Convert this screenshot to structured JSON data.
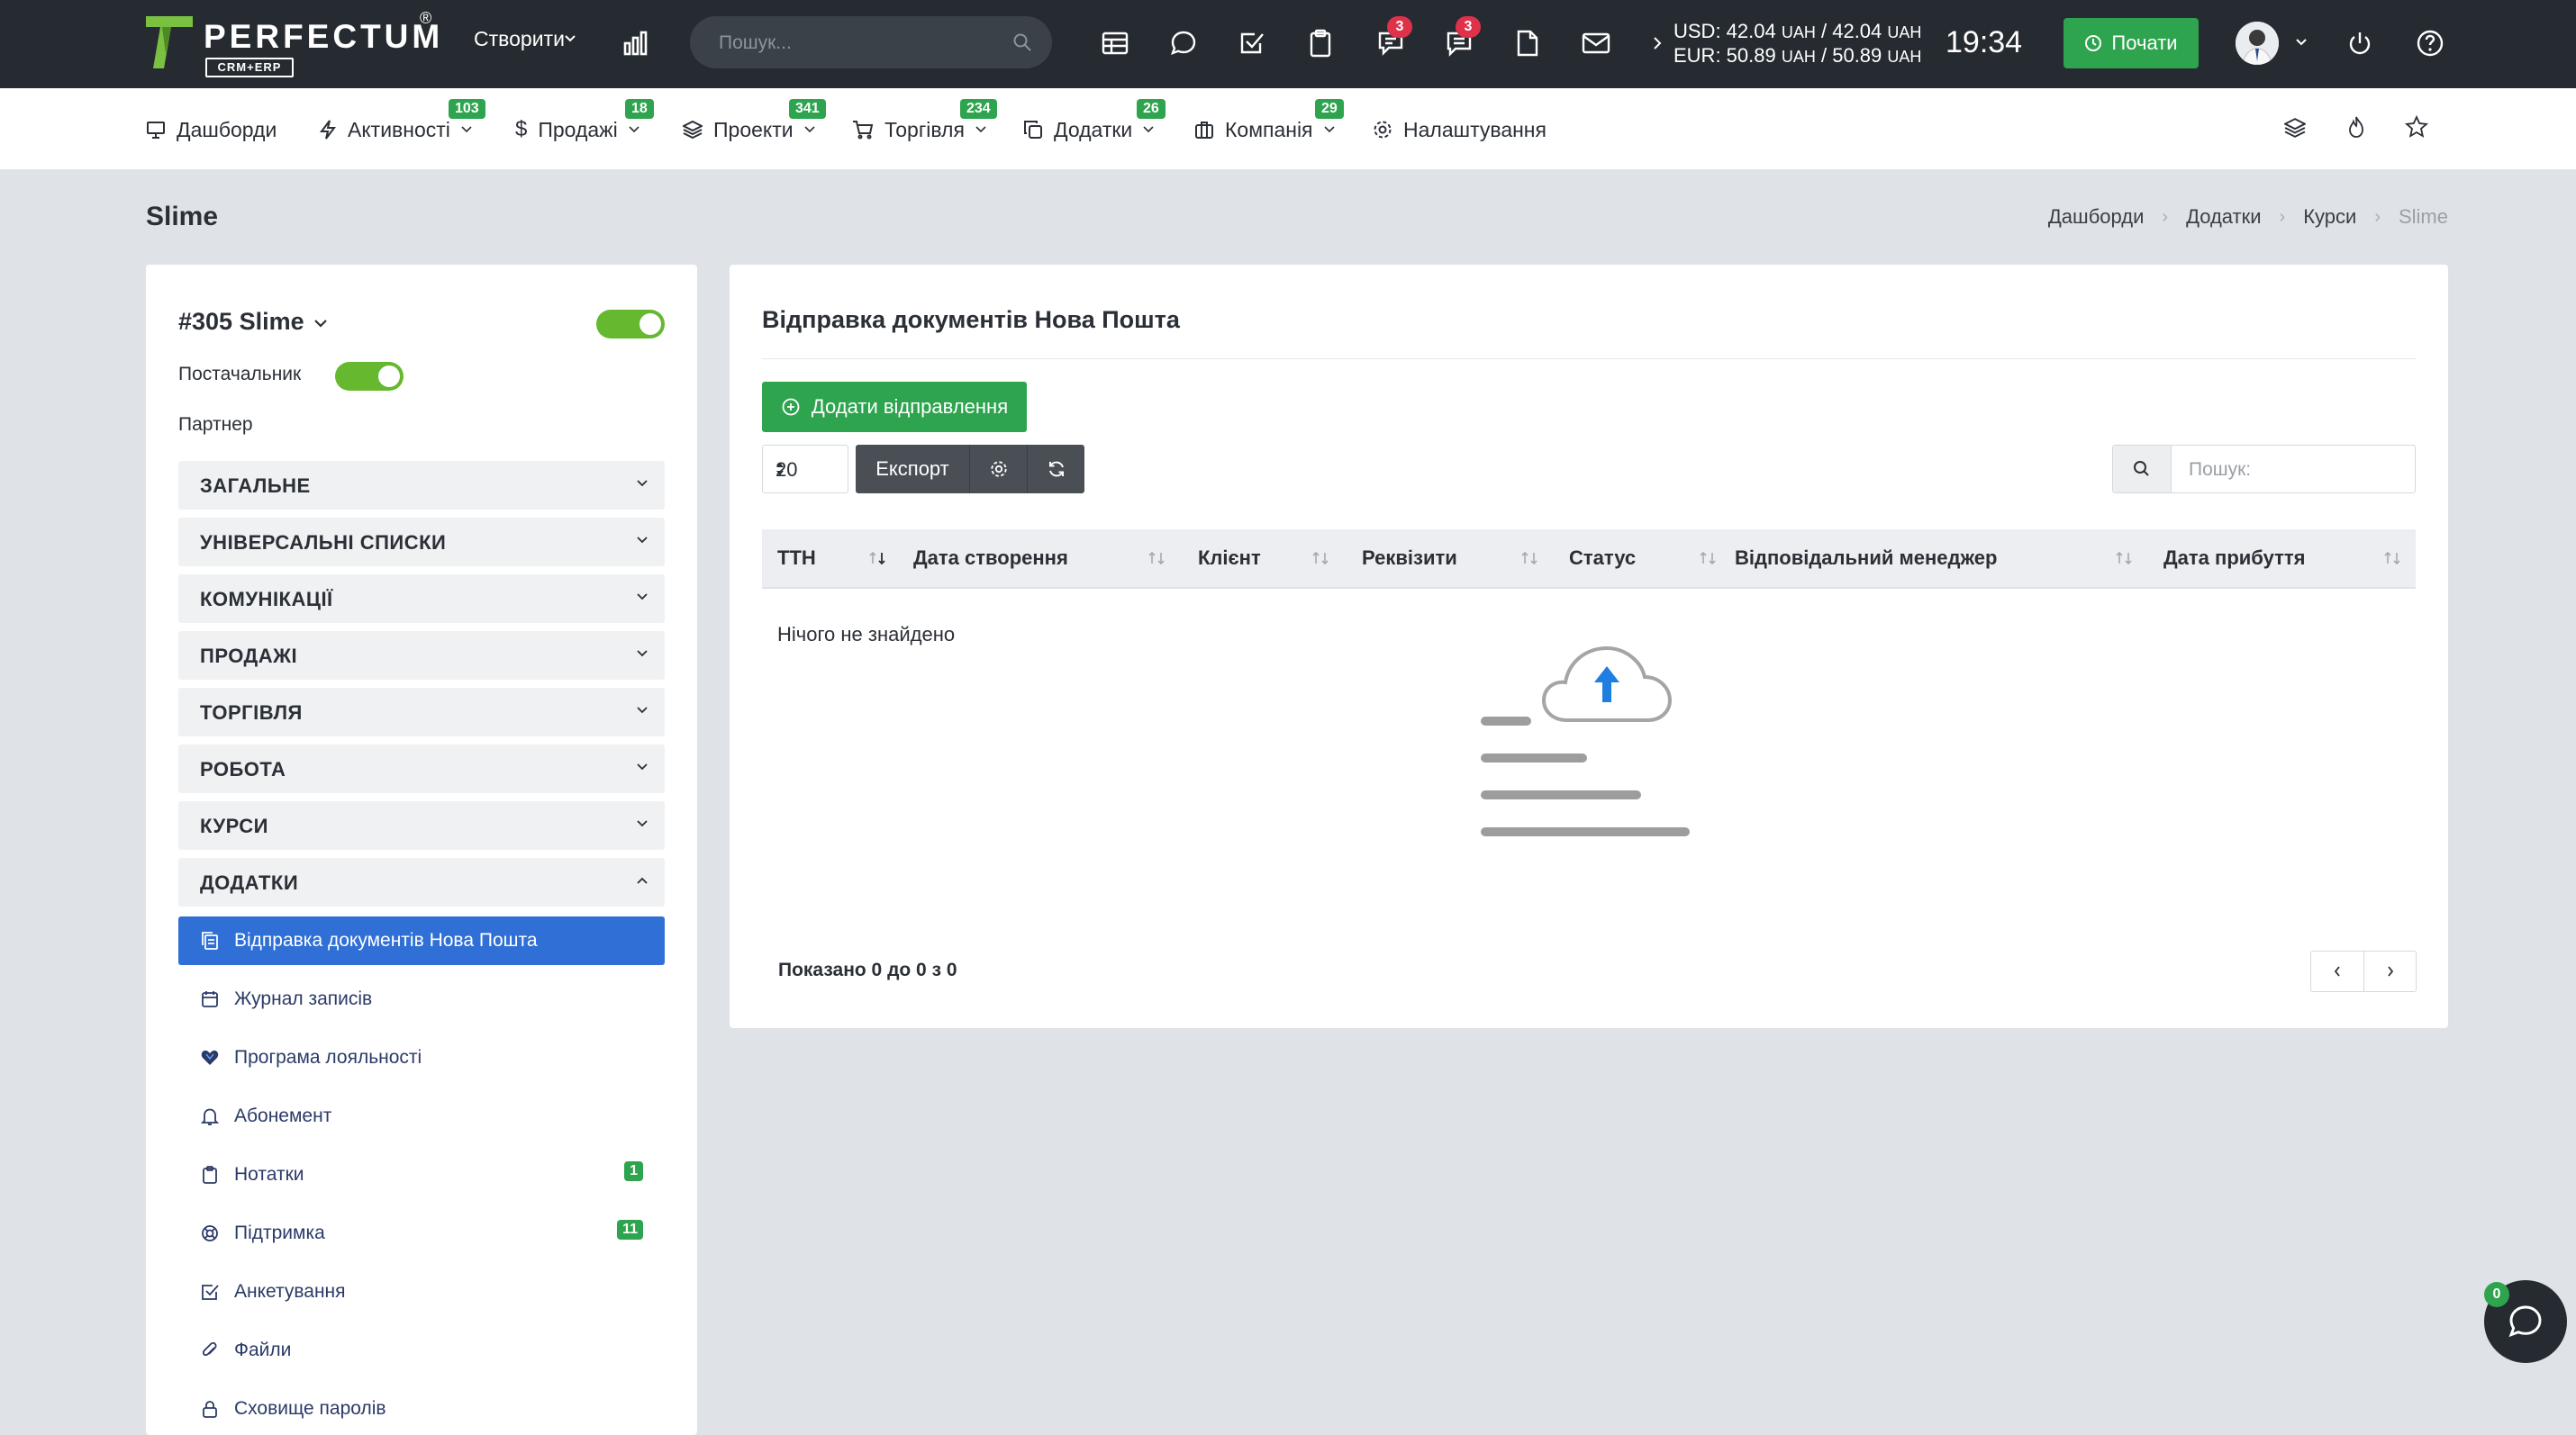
{
  "brand": {
    "name": "PERFECTUM",
    "reg": "®",
    "sub": "CRM+ERP"
  },
  "topbar": {
    "create_label": "Створити",
    "search_placeholder": "Пошук...",
    "chat_badge": "3",
    "messages_badge": "3",
    "rates": {
      "usd": "USD: 42.04",
      "usd_unit1": "UAH",
      "usd_sep": "/ 42.04",
      "usd_unit2": "UAH",
      "eur": "EUR: 50.89",
      "eur_unit1": "UAH",
      "eur_sep": "/ 50.89",
      "eur_unit2": "UAH"
    },
    "time": "19:34",
    "start_label": "Почати"
  },
  "menu": [
    {
      "label": "Дашборди",
      "icon": "monitor-icon",
      "badge": ""
    },
    {
      "label": "Активності",
      "icon": "bolt-icon",
      "badge": "103"
    },
    {
      "label": "Продажі",
      "icon": "dollar-icon",
      "badge": "18"
    },
    {
      "label": "Проекти",
      "icon": "layers-icon",
      "badge": "341"
    },
    {
      "label": "Торгівля",
      "icon": "cart-icon",
      "badge": "234"
    },
    {
      "label": "Додатки",
      "icon": "copy-icon",
      "badge": "26"
    },
    {
      "label": "Компанія",
      "icon": "briefcase-icon",
      "badge": "29"
    },
    {
      "label": "Налаштування",
      "icon": "gear-icon",
      "badge": ""
    }
  ],
  "page": {
    "title": "Slime",
    "breadcrumbs": [
      "Дашборди",
      "Додатки",
      "Курси",
      "Slime"
    ]
  },
  "client": {
    "title": "#305 Slime",
    "supplier_label": "Постачальник",
    "partner_label": "Партнер",
    "sections": [
      "ЗАГАЛЬНЕ",
      "УНІВЕРСАЛЬНІ СПИСКИ",
      "КОМУНІКАЦІЇ",
      "ПРОДАЖІ",
      "ТОРГІВЛЯ",
      "РОБОТА",
      "КУРСИ",
      "ДОДАТКИ"
    ],
    "addons": [
      {
        "label": "Відправка документів Нова Пошта",
        "icon": "documents-icon",
        "count": ""
      },
      {
        "label": "Журнал записів",
        "icon": "calendar-icon",
        "count": ""
      },
      {
        "label": "Програма лояльності",
        "icon": "heart-icon",
        "count": ""
      },
      {
        "label": "Абонемент",
        "icon": "bell-icon",
        "count": ""
      },
      {
        "label": "Нотатки",
        "icon": "clipboard-icon",
        "count": "1"
      },
      {
        "label": "Підтримка",
        "icon": "lifebuoy-icon",
        "count": "11"
      },
      {
        "label": "Анкетування",
        "icon": "checkbox-icon",
        "count": ""
      },
      {
        "label": "Файли",
        "icon": "paperclip-icon",
        "count": ""
      },
      {
        "label": "Сховище паролів",
        "icon": "lock-icon",
        "count": ""
      }
    ]
  },
  "main": {
    "title": "Відправка документів Нова Пошта",
    "add_button": "Додати відправлення",
    "per_page": "20",
    "export_label": "Експорт",
    "search_placeholder": "Пошук:",
    "columns": [
      "ТТН",
      "Дата створення",
      "Клієнт",
      "Реквізити",
      "Статус",
      "Відповідальний менеджер",
      "Дата прибуття"
    ],
    "empty_text": "Нічого не знайдено",
    "shown_text": "Показано 0 до 0 з 0"
  },
  "chat": {
    "count": "0"
  },
  "colors": {
    "accent_green": "#2ea44f",
    "active_blue": "#2f6fd6",
    "topbar": "#262b31",
    "toggle_green": "#66b82f",
    "badge_red": "#e0314b"
  }
}
